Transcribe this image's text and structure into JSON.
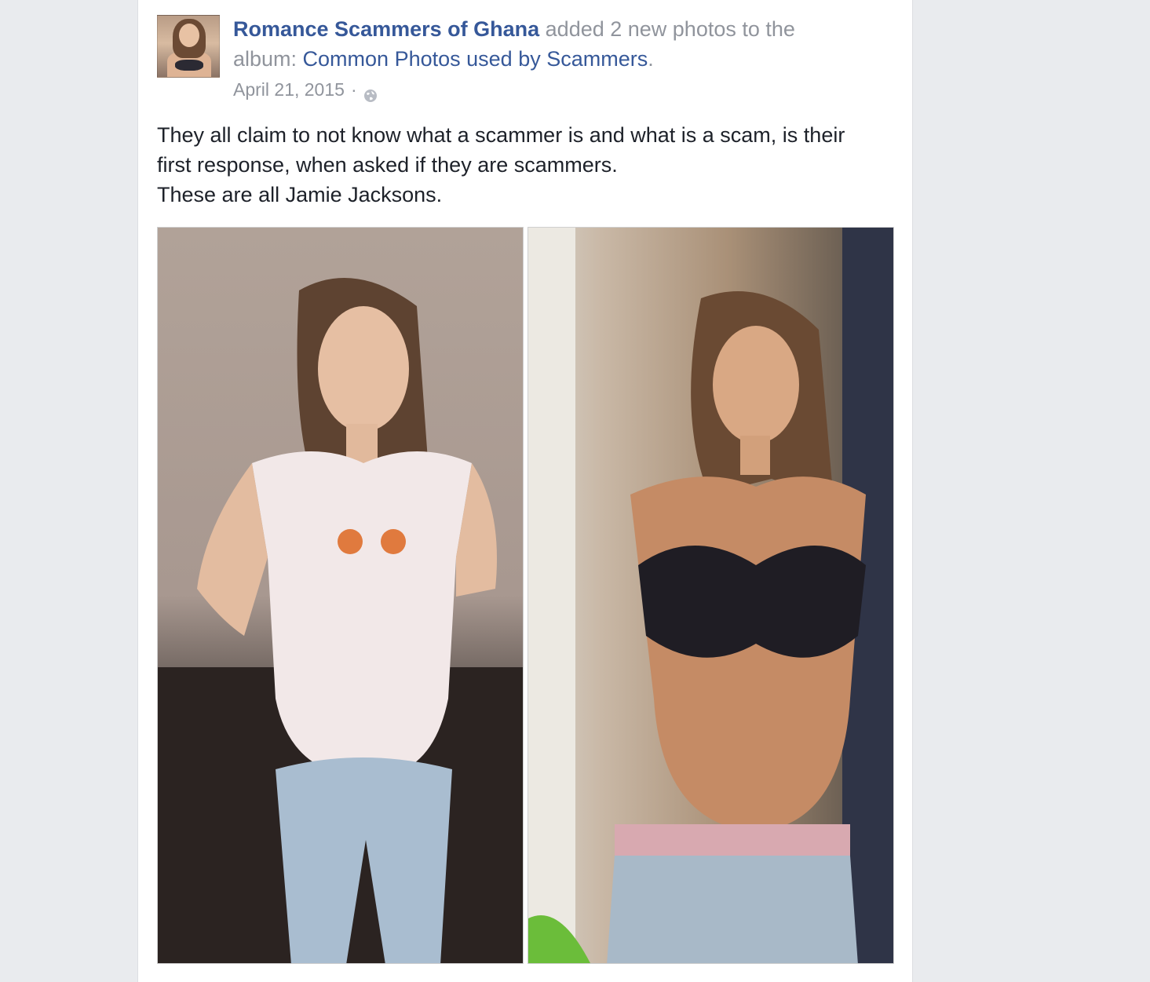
{
  "post": {
    "author": "Romance Scammers of Ghana",
    "action_prefix": " added 2 new photos to the album: ",
    "album": "Common Photos used by Scammers",
    "action_suffix": ".",
    "date": "April 21, 2015",
    "separator": "·",
    "privacy_icon": "globe-icon",
    "text_lines": [
      "They all claim to not know what a scammer is and what is a scam, is their first response, when asked if they are scammers.",
      "These are all Jamie Jacksons."
    ],
    "photos": [
      {
        "icon": "photo-woman-white-tshirt"
      },
      {
        "icon": "photo-woman-black-bra"
      }
    ]
  },
  "colors": {
    "link": "#365899",
    "meta": "#90949c",
    "text": "#1d2129",
    "background": "#e9ebee",
    "card": "#ffffff"
  }
}
